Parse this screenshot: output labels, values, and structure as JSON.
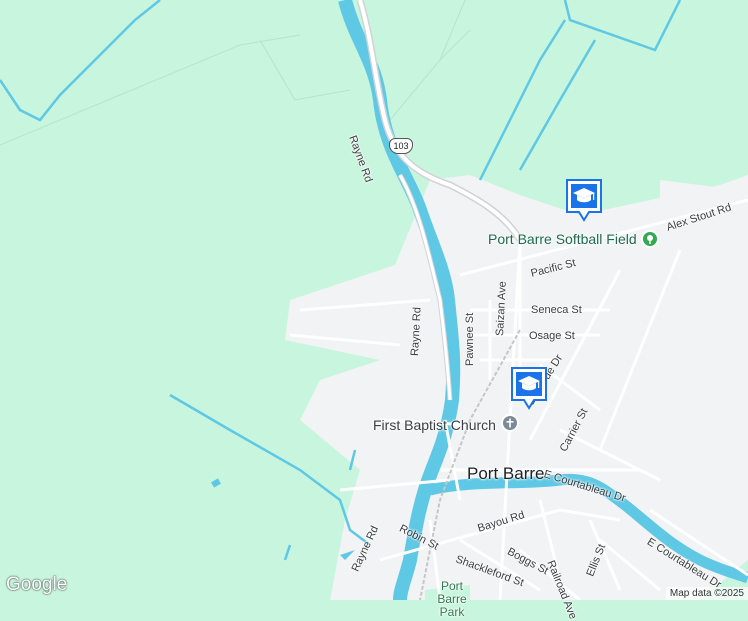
{
  "map": {
    "route_shield": "103",
    "town_label": "Port Barre",
    "poi": {
      "softball_field": "Port Barre Softball Field",
      "church": "First Baptist Church",
      "park": "Port Barre Park"
    },
    "streets": {
      "rayne_rd_north": "Rayne Rd",
      "rayne_rd_mid": "Rayne Rd",
      "rayne_rd_south": "Rayne Rd",
      "alex_stout": "Alex Stout Rd",
      "pacific": "Pacific St",
      "seneca": "Seneca St",
      "osage": "Osage St",
      "saizan": "Saizan Ave",
      "pawnee": "Pawnee St",
      "bellevue": "Bellevue Dr",
      "carrier": "Carrier St",
      "e_courtableau_1": "E Courtableau Dr",
      "e_courtableau_2": "E Courtableau Dr",
      "bayou": "Bayou Rd",
      "robin": "Robin St",
      "boggs": "Boggs St",
      "shackleford": "Shackleford St",
      "railroad": "Railroad Ave",
      "ellis": "Ellis St"
    },
    "school_icon": "graduation-cap-icon",
    "softball_icon": "park-icon",
    "church_icon": "cross-icon",
    "colors": {
      "land": "#c8f5dd",
      "urban": "#f1f3f4",
      "water": "#5ec8e5",
      "road": "#ffffff",
      "highway": "#d0d3d6",
      "school": "#1a73e8",
      "park_poi": "#34a853"
    }
  },
  "footer": {
    "logo": "Google",
    "attribution": "Map data ©2025"
  }
}
